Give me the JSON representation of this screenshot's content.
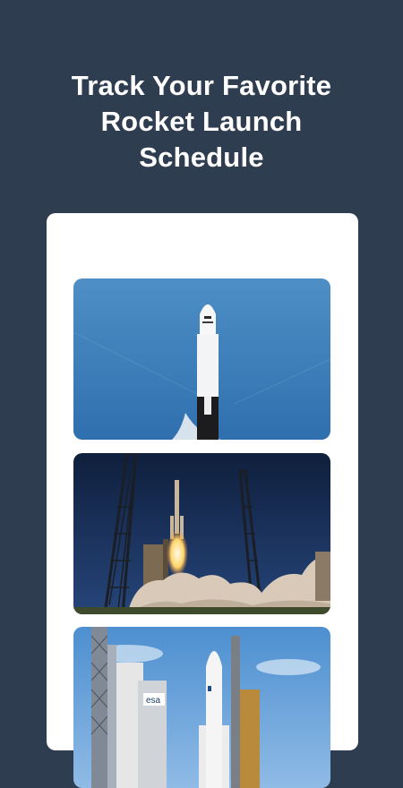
{
  "headline": {
    "line1": "Track Your Favorite",
    "line2": "Rocket Launch",
    "line3": "Schedule"
  },
  "gallery": {
    "images": [
      {
        "name": "rocket-capsule-photo"
      },
      {
        "name": "rocket-launch-towers-photo"
      },
      {
        "name": "rocket-esa-pad-photo"
      }
    ],
    "visible_sign_text": "esa"
  },
  "colors": {
    "background": "#2e3d4f",
    "card": "#ffffff",
    "headline_text": "#ffffff"
  }
}
